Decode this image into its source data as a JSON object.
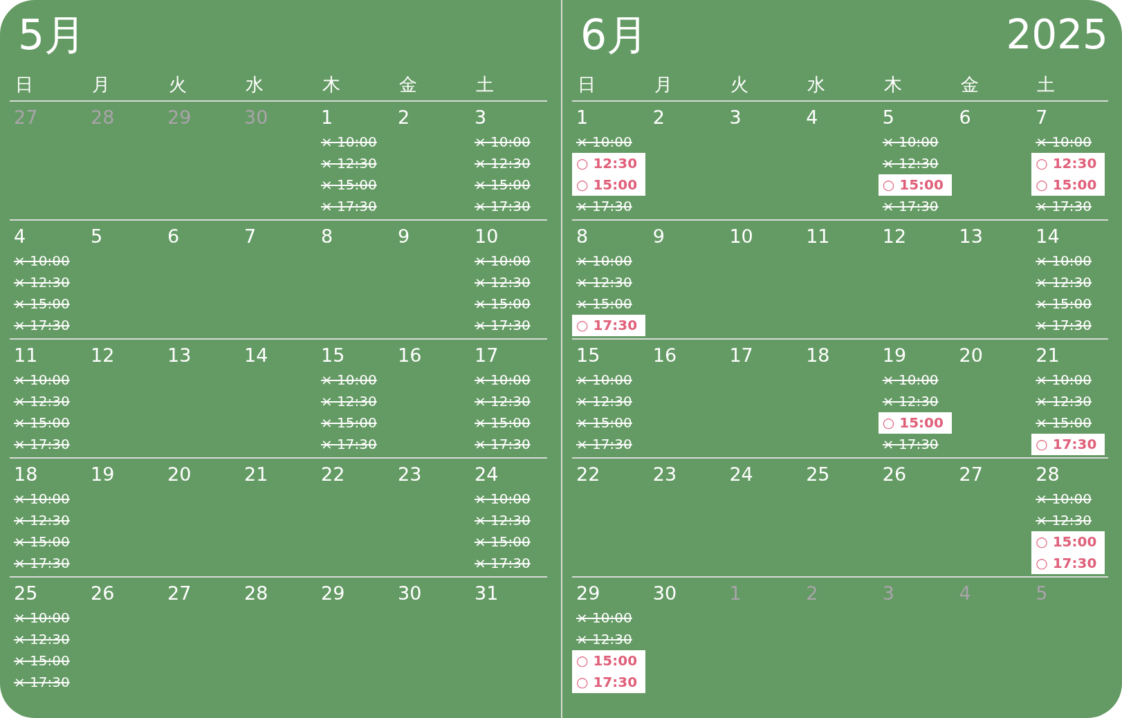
{
  "months": [
    {
      "title": "5月",
      "weekdays": [
        "日",
        "月",
        "火",
        "水",
        "木",
        "金",
        "土"
      ],
      "weeks": [
        [
          {
            "day": "27",
            "outside": true
          },
          {
            "day": "28",
            "outside": true
          },
          {
            "day": "29",
            "outside": true
          },
          {
            "day": "30",
            "outside": true
          },
          {
            "day": "1",
            "outside": false,
            "slots": [
              {
                "label": "× 10:00",
                "available": false
              },
              {
                "label": "× 12:30",
                "available": false
              },
              {
                "label": "× 15:00",
                "available": false
              },
              {
                "label": "× 17:30",
                "available": false
              }
            ]
          },
          {
            "day": "2",
            "outside": false
          },
          {
            "day": "3",
            "outside": false,
            "slots": [
              {
                "label": "× 10:00",
                "available": false
              },
              {
                "label": "× 12:30",
                "available": false
              },
              {
                "label": "× 15:00",
                "available": false
              },
              {
                "label": "× 17:30",
                "available": false
              }
            ]
          }
        ],
        [
          {
            "day": "4",
            "outside": false,
            "slots": [
              {
                "label": "× 10:00",
                "available": false
              },
              {
                "label": "× 12:30",
                "available": false
              },
              {
                "label": "× 15:00",
                "available": false
              },
              {
                "label": "× 17:30",
                "available": false
              }
            ]
          },
          {
            "day": "5",
            "outside": false
          },
          {
            "day": "6",
            "outside": false
          },
          {
            "day": "7",
            "outside": false
          },
          {
            "day": "8",
            "outside": false
          },
          {
            "day": "9",
            "outside": false
          },
          {
            "day": "10",
            "outside": false,
            "slots": [
              {
                "label": "× 10:00",
                "available": false
              },
              {
                "label": "× 12:30",
                "available": false
              },
              {
                "label": "× 15:00",
                "available": false
              },
              {
                "label": "× 17:30",
                "available": false
              }
            ]
          }
        ],
        [
          {
            "day": "11",
            "outside": false,
            "slots": [
              {
                "label": "× 10:00",
                "available": false
              },
              {
                "label": "× 12:30",
                "available": false
              },
              {
                "label": "× 15:00",
                "available": false
              },
              {
                "label": "× 17:30",
                "available": false
              }
            ]
          },
          {
            "day": "12",
            "outside": false
          },
          {
            "day": "13",
            "outside": false
          },
          {
            "day": "14",
            "outside": false
          },
          {
            "day": "15",
            "outside": false,
            "slots": [
              {
                "label": "× 10:00",
                "available": false
              },
              {
                "label": "× 12:30",
                "available": false
              },
              {
                "label": "× 15:00",
                "available": false
              },
              {
                "label": "× 17:30",
                "available": false
              }
            ]
          },
          {
            "day": "16",
            "outside": false
          },
          {
            "day": "17",
            "outside": false,
            "slots": [
              {
                "label": "× 10:00",
                "available": false
              },
              {
                "label": "× 12:30",
                "available": false
              },
              {
                "label": "× 15:00",
                "available": false
              },
              {
                "label": "× 17:30",
                "available": false
              }
            ]
          }
        ],
        [
          {
            "day": "18",
            "outside": false,
            "slots": [
              {
                "label": "× 10:00",
                "available": false
              },
              {
                "label": "× 12:30",
                "available": false
              },
              {
                "label": "× 15:00",
                "available": false
              },
              {
                "label": "× 17:30",
                "available": false
              }
            ]
          },
          {
            "day": "19",
            "outside": false
          },
          {
            "day": "20",
            "outside": false
          },
          {
            "day": "21",
            "outside": false
          },
          {
            "day": "22",
            "outside": false
          },
          {
            "day": "23",
            "outside": false
          },
          {
            "day": "24",
            "outside": false,
            "slots": [
              {
                "label": "× 10:00",
                "available": false
              },
              {
                "label": "× 12:30",
                "available": false
              },
              {
                "label": "× 15:00",
                "available": false
              },
              {
                "label": "× 17:30",
                "available": false
              }
            ]
          }
        ],
        [
          {
            "day": "25",
            "outside": false,
            "slots": [
              {
                "label": "× 10:00",
                "available": false
              },
              {
                "label": "× 12:30",
                "available": false
              },
              {
                "label": "× 15:00",
                "available": false
              },
              {
                "label": "× 17:30",
                "available": false
              }
            ]
          },
          {
            "day": "26",
            "outside": false
          },
          {
            "day": "27",
            "outside": false
          },
          {
            "day": "28",
            "outside": false
          },
          {
            "day": "29",
            "outside": false
          },
          {
            "day": "30",
            "outside": false
          },
          {
            "day": "31",
            "outside": false
          }
        ]
      ]
    },
    {
      "title": "6月",
      "year": "2025",
      "weekdays": [
        "日",
        "月",
        "火",
        "水",
        "木",
        "金",
        "土"
      ],
      "weeks": [
        [
          {
            "day": "1",
            "outside": false,
            "slots": [
              {
                "label": "× 10:00",
                "available": false
              },
              {
                "label": "○ 12:30",
                "available": true
              },
              {
                "label": "○ 15:00",
                "available": true
              },
              {
                "label": "× 17:30",
                "available": false
              }
            ]
          },
          {
            "day": "2",
            "outside": false
          },
          {
            "day": "3",
            "outside": false
          },
          {
            "day": "4",
            "outside": false
          },
          {
            "day": "5",
            "outside": false,
            "slots": [
              {
                "label": "× 10:00",
                "available": false
              },
              {
                "label": "× 12:30",
                "available": false
              },
              {
                "label": "○ 15:00",
                "available": true
              },
              {
                "label": "× 17:30",
                "available": false
              }
            ]
          },
          {
            "day": "6",
            "outside": false
          },
          {
            "day": "7",
            "outside": false,
            "slots": [
              {
                "label": "× 10:00",
                "available": false
              },
              {
                "label": "○ 12:30",
                "available": true
              },
              {
                "label": "○ 15:00",
                "available": true
              },
              {
                "label": "× 17:30",
                "available": false
              }
            ]
          }
        ],
        [
          {
            "day": "8",
            "outside": false,
            "slots": [
              {
                "label": "× 10:00",
                "available": false
              },
              {
                "label": "× 12:30",
                "available": false
              },
              {
                "label": "× 15:00",
                "available": false
              },
              {
                "label": "○ 17:30",
                "available": true
              }
            ]
          },
          {
            "day": "9",
            "outside": false
          },
          {
            "day": "10",
            "outside": false
          },
          {
            "day": "11",
            "outside": false
          },
          {
            "day": "12",
            "outside": false
          },
          {
            "day": "13",
            "outside": false
          },
          {
            "day": "14",
            "outside": false,
            "slots": [
              {
                "label": "× 10:00",
                "available": false
              },
              {
                "label": "× 12:30",
                "available": false
              },
              {
                "label": "× 15:00",
                "available": false
              },
              {
                "label": "× 17:30",
                "available": false
              }
            ]
          }
        ],
        [
          {
            "day": "15",
            "outside": false,
            "slots": [
              {
                "label": "× 10:00",
                "available": false
              },
              {
                "label": "× 12:30",
                "available": false
              },
              {
                "label": "× 15:00",
                "available": false
              },
              {
                "label": "× 17:30",
                "available": false
              }
            ]
          },
          {
            "day": "16",
            "outside": false
          },
          {
            "day": "17",
            "outside": false
          },
          {
            "day": "18",
            "outside": false
          },
          {
            "day": "19",
            "outside": false,
            "slots": [
              {
                "label": "× 10:00",
                "available": false
              },
              {
                "label": "× 12:30",
                "available": false
              },
              {
                "label": "○ 15:00",
                "available": true
              },
              {
                "label": "× 17:30",
                "available": false
              }
            ]
          },
          {
            "day": "20",
            "outside": false
          },
          {
            "day": "21",
            "outside": false,
            "slots": [
              {
                "label": "× 10:00",
                "available": false
              },
              {
                "label": "× 12:30",
                "available": false
              },
              {
                "label": "× 15:00",
                "available": false
              },
              {
                "label": "○ 17:30",
                "available": true
              }
            ]
          }
        ],
        [
          {
            "day": "22",
            "outside": false
          },
          {
            "day": "23",
            "outside": false
          },
          {
            "day": "24",
            "outside": false
          },
          {
            "day": "25",
            "outside": false
          },
          {
            "day": "26",
            "outside": false
          },
          {
            "day": "27",
            "outside": false
          },
          {
            "day": "28",
            "outside": false,
            "slots": [
              {
                "label": "× 10:00",
                "available": false
              },
              {
                "label": "× 12:30",
                "available": false
              },
              {
                "label": "○ 15:00",
                "available": true
              },
              {
                "label": "○ 17:30",
                "available": true
              }
            ]
          }
        ],
        [
          {
            "day": "29",
            "outside": false,
            "slots": [
              {
                "label": "× 10:00",
                "available": false
              },
              {
                "label": "× 12:30",
                "available": false
              },
              {
                "label": "○ 15:00",
                "available": true
              },
              {
                "label": "○ 17:30",
                "available": true
              }
            ]
          },
          {
            "day": "30",
            "outside": false
          },
          {
            "day": "1",
            "outside": true
          },
          {
            "day": "2",
            "outside": true
          },
          {
            "day": "3",
            "outside": true
          },
          {
            "day": "4",
            "outside": true
          },
          {
            "day": "5",
            "outside": true
          }
        ]
      ]
    }
  ]
}
